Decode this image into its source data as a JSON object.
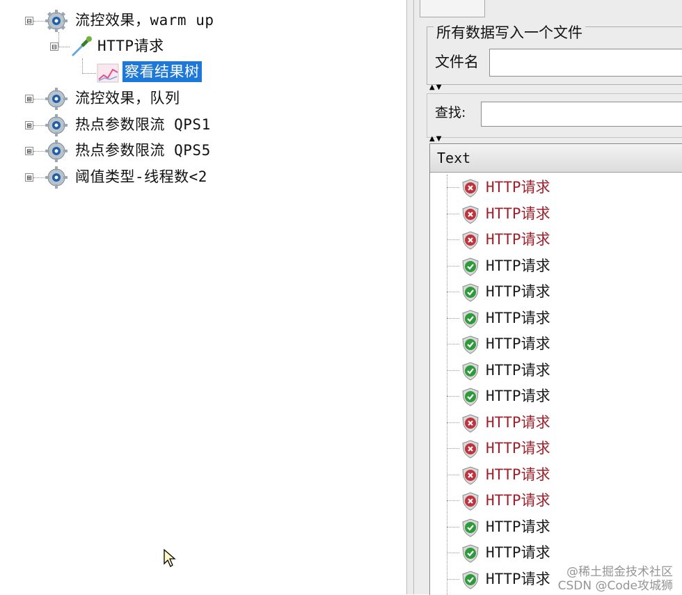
{
  "tree": {
    "nodes": [
      {
        "label": "流控效果，warm up",
        "expanded": true,
        "icon": "gear-icon"
      },
      {
        "label": "HTTP请求",
        "expanded": true,
        "icon": "pipette-icon"
      },
      {
        "label": "察看结果树",
        "selected": true,
        "icon": "chart-icon"
      },
      {
        "label": "流控效果，队列",
        "expanded": false,
        "icon": "gear-icon"
      },
      {
        "label": "热点参数限流 QPS1",
        "expanded": false,
        "icon": "gear-icon"
      },
      {
        "label": "热点参数限流 QPS5",
        "expanded": false,
        "icon": "gear-icon"
      },
      {
        "label": "阈值类型-线程数<2",
        "expanded": false,
        "icon": "gear-icon"
      }
    ],
    "expand_symbol": "⊟",
    "collapse_symbol": "⊞"
  },
  "panel": {
    "group_title": "所有数据写入一个文件",
    "filename_label": "文件名",
    "filename_value": "",
    "find_label": "查找:",
    "find_value": "",
    "results_header": "Text",
    "results": [
      {
        "label": "HTTP请求",
        "status": "fail"
      },
      {
        "label": "HTTP请求",
        "status": "fail"
      },
      {
        "label": "HTTP请求",
        "status": "fail"
      },
      {
        "label": "HTTP请求",
        "status": "ok"
      },
      {
        "label": "HTTP请求",
        "status": "ok"
      },
      {
        "label": "HTTP请求",
        "status": "ok"
      },
      {
        "label": "HTTP请求",
        "status": "ok"
      },
      {
        "label": "HTTP请求",
        "status": "ok"
      },
      {
        "label": "HTTP请求",
        "status": "ok"
      },
      {
        "label": "HTTP请求",
        "status": "fail"
      },
      {
        "label": "HTTP请求",
        "status": "fail"
      },
      {
        "label": "HTTP请求",
        "status": "fail"
      },
      {
        "label": "HTTP请求",
        "status": "fail"
      },
      {
        "label": "HTTP请求",
        "status": "ok"
      },
      {
        "label": "HTTP请求",
        "status": "ok"
      },
      {
        "label": "HTTP请求",
        "status": "ok"
      }
    ]
  },
  "watermark": {
    "line1": "@稀土掘金技术社区",
    "line2": "CSDN @Code攻城狮"
  },
  "colors": {
    "selection": "#1e78d7",
    "fail_text": "#a0202a",
    "ok_shield": "#2e9b3a",
    "fail_shield": "#c0323c"
  }
}
